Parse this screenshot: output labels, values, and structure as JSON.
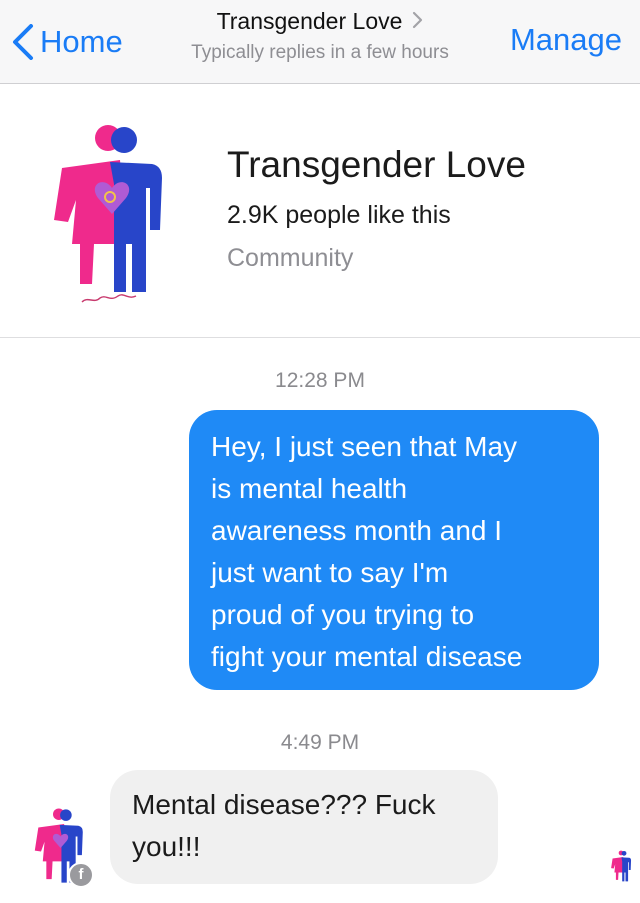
{
  "navbar": {
    "back_label": "Home",
    "title": "Transgender Love",
    "subtitle": "Typically replies in a few hours",
    "manage_label": "Manage",
    "accent_color": "#1a7cf6"
  },
  "profile": {
    "name": "Transgender Love",
    "likes": "2.9K people like this",
    "category": "Community",
    "logo_icon": "transgender-symbol-logo",
    "logo_colors": [
      "#ef2a8c",
      "#2845c9"
    ]
  },
  "conversation": {
    "messages": [
      {
        "timestamp": "12:28 PM",
        "direction": "outgoing",
        "lines": [
          "Hey, I just seen that May",
          "is mental health",
          "awareness month and I",
          "just want to say I'm",
          "proud of you trying to",
          "fight your mental disease"
        ]
      },
      {
        "timestamp": "4:49 PM",
        "direction": "incoming",
        "lines": [
          "Mental disease??? Fuck",
          "you!!!"
        ]
      }
    ],
    "outgoing_bubble_color": "#1f8af6",
    "incoming_bubble_color": "#f0f0f0"
  }
}
